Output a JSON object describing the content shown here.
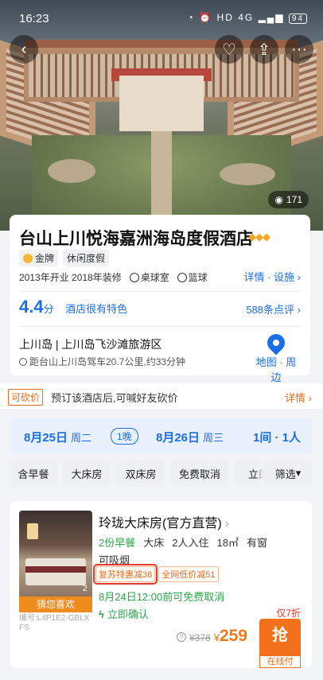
{
  "status_bar": {
    "time": "16:23",
    "icons_text": "HD 4G",
    "battery": "94"
  },
  "header": {
    "photo_count": "171"
  },
  "hotel": {
    "name": "台山上川悦海嘉洲海岛度假酒店",
    "tags": [
      "金牌",
      "休闲度假"
    ],
    "opened": "2013年开业 2018年装修",
    "facilities": [
      "桌球室",
      "篮球"
    ],
    "detail_link": "详情 · 设施",
    "score": "4.4",
    "score_unit": "分",
    "score_text": "酒店很有特色",
    "reviews": "588条点评",
    "location_title": "上川岛 | 上川岛飞沙滩旅游区",
    "location_desc": "距台山上川岛驾车20.7公里,约33分钟",
    "map_label": "地图 · 周边"
  },
  "bargain": {
    "badge": "可砍价",
    "text": "预订该酒店后,可喊好友砍价",
    "more": "详情"
  },
  "dates": {
    "checkin": "8月25日",
    "checkin_week": "周二",
    "nights": "1晚",
    "checkout": "8月26日",
    "checkout_week": "周三",
    "guests": "1间 · 1人"
  },
  "filters": {
    "chips": [
      "含早餐",
      "大床房",
      "双床房",
      "免费取消",
      "立即"
    ],
    "filter_label": "筛选"
  },
  "room": {
    "name": "玲珑大床房(官方直营)",
    "breakfast": "2份早餐",
    "bed": "大床",
    "occupancy": "2人入住",
    "area": "18㎡",
    "window": "有窗",
    "smoking": "可吸烟",
    "promos": [
      "复苏特惠减38",
      "全网低价减51"
    ],
    "photo_count": "2",
    "guess_label": "猜您喜欢",
    "code": "编号:L4P1E2-GBLXFS",
    "cancel": "8月24日12:00前可免费取消",
    "confirm": "立即确认",
    "discount": "仅7折",
    "old_price": "¥378",
    "currency": "¥",
    "price": "259",
    "book_label": "抢",
    "pay_label": "在线付"
  }
}
